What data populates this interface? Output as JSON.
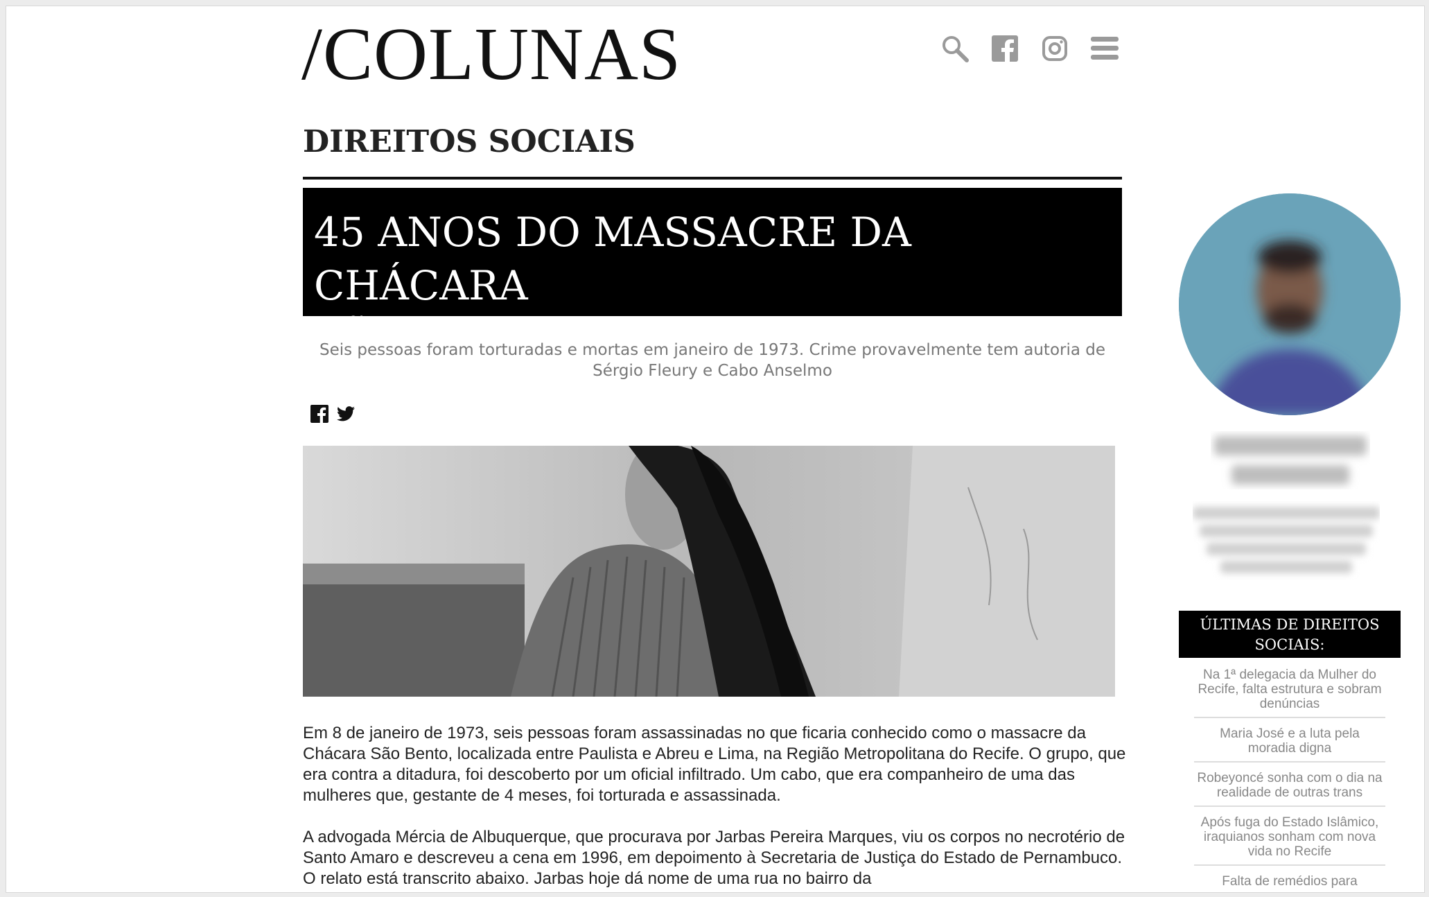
{
  "site": {
    "logo": "/COLUNAS"
  },
  "header_icons": [
    "search-icon",
    "facebook-icon",
    "instagram-icon",
    "menu-icon"
  ],
  "section": {
    "title": "DIREITOS SOCIAIS"
  },
  "article": {
    "headline_line1": "45 ANOS DO MASSACRE DA CHÁCARA",
    "headline_line2": "SÃO BENTO",
    "subtitle": "Seis pessoas foram torturadas e mortas em janeiro de 1973. Crime provavelmente tem autoria de Sérgio Fleury e Cabo Anselmo",
    "share_icons": [
      "facebook-icon",
      "twitter-icon"
    ],
    "paragraphs": [
      "Em 8 de janeiro de 1973, seis pessoas foram assassinadas no que ficaria conhecido como o massacre da Chácara São Bento, localizada entre Paulista e Abreu e Lima, na Região Metropolitana do Recife. O grupo, que era contra a ditadura, foi descoberto por um oficial infiltrado. Um cabo, que era companheiro de uma das mulheres que, gestante de 4 meses, foi torturada e assassinada.",
      "A advogada Mércia de Albuquerque, que procurava por Jarbas Pereira Marques, viu os corpos no necrotério de Santo Amaro e descreveu a cena em 1996, em depoimento à Secretaria de Justiça do Estado de Pernambuco. O relato está transcrito abaixo. Jarbas hoje dá nome de uma rua no bairro da"
    ]
  },
  "sidebar": {
    "latest_title": "ÚLTIMAS DE DIREITOS SOCIAIS:",
    "latest_items": [
      "Na 1ª delegacia da Mulher do Recife, falta estrutura e sobram denúncias",
      "Maria José e a luta pela moradia digna",
      "Robeyoncé sonha com o dia na realidade de outras trans",
      "Após fuga do Estado Islâmico, iraquianos sonham com nova vida no Recife",
      "Falta de remédios para"
    ]
  },
  "colors": {
    "accent": "#000000",
    "muted_text": "#888888",
    "icon": "#9a9a9a",
    "avatar_bg": "#6aa3b9"
  }
}
